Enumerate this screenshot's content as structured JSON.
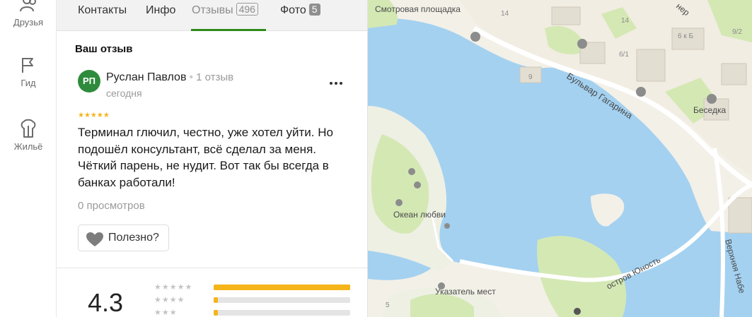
{
  "sidebar": {
    "items": [
      {
        "label": "Друзья",
        "icon": "friends-icon"
      },
      {
        "label": "Гид",
        "icon": "flag-icon"
      },
      {
        "label": "Жильё",
        "icon": "lodging-icon"
      }
    ]
  },
  "tabs": [
    {
      "label": "Контакты"
    },
    {
      "label": "Инфо"
    },
    {
      "label": "Отзывы",
      "count": "496",
      "active": true
    },
    {
      "label": "Фото",
      "count": "5"
    }
  ],
  "review_section": {
    "title": "Ваш отзыв",
    "avatar_initials": "РП",
    "author_name": "Руслан Павлов",
    "author_reviews": "1 отзыв",
    "date": "сегодня",
    "stars": "★★★★★",
    "text": "Терминал глючил, честно, уже хотел уйти. Но подошёл консультант, всё сделал за меня. Чёткий парень, не нудит. Вот так бы всегда в банках работали!",
    "views": "0 просмотров",
    "useful_label": "Полезно?"
  },
  "rating": {
    "value": "4.3",
    "distribution": [
      {
        "stars": "★★★★★",
        "fraction": 1.0
      },
      {
        "stars": "★★★★",
        "fraction": 0.03
      },
      {
        "stars": "★★★",
        "fraction": 0.03
      }
    ]
  },
  "map": {
    "labels": {
      "viewpoint": "Смотровая площадка",
      "boulevard": "Бульвар Гагарина",
      "gazebo": "Беседка",
      "ocean_love": "Океан любви",
      "youth_island": "остров Юность",
      "signpost": "Указатель мест",
      "upper_street": "Верхняя Набе",
      "top_street": "нер"
    },
    "house_numbers": [
      "14",
      "14",
      "6 к Б",
      "9/2",
      "6/1",
      "9",
      "5"
    ],
    "colors": {
      "water": "#a4d1f0",
      "land": "#f3f0e8",
      "park": "#d4e8b4",
      "road": "#ffffff"
    }
  }
}
